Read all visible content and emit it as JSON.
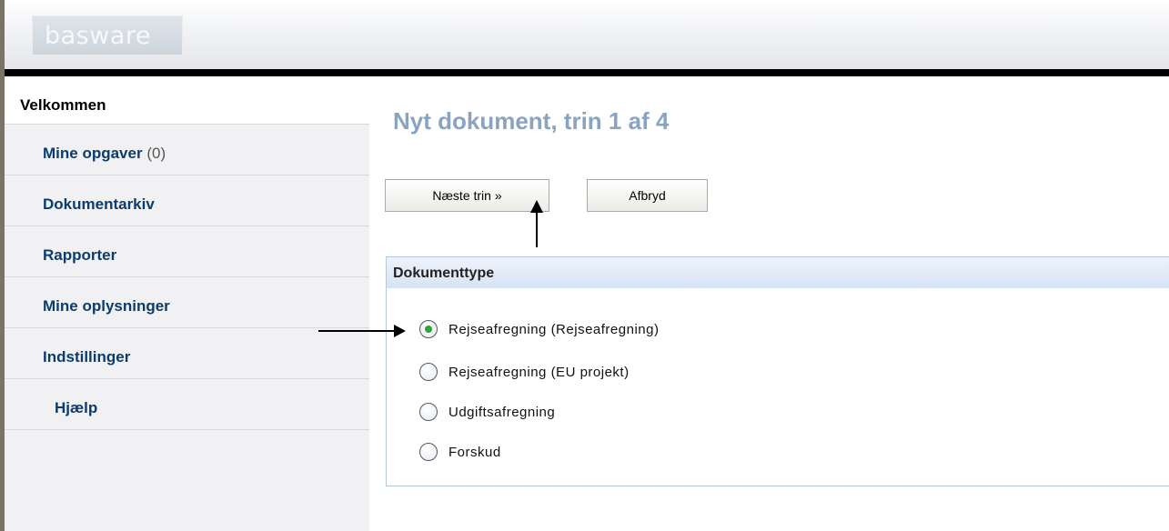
{
  "header": {
    "logo_text": "basware"
  },
  "sidebar": {
    "home_label": "Velkommen",
    "items": [
      {
        "label": "Mine opgaver",
        "count": "(0)"
      },
      {
        "label": "Dokumentarkiv"
      },
      {
        "label": "Rapporter"
      },
      {
        "label": "Mine oplysninger"
      },
      {
        "label": "Indstillinger"
      },
      {
        "label": "Hjælp"
      }
    ]
  },
  "main": {
    "title": "Nyt dokument, trin 1 af 4",
    "buttons": {
      "next": "Næste trin »",
      "cancel": "Afbryd"
    },
    "doc_type": {
      "heading": "Dokumenttype",
      "selected": "Rejseafregning (Rejseafregning)",
      "options": [
        "Rejseafregning (Rejseafregning)",
        "Rejseafregning (EU projekt)",
        "Udgiftsafregning",
        "Forskud"
      ]
    }
  },
  "colors": {
    "nav_link": "#0a3d6e",
    "title": "#8aa4c0",
    "radio_selected": "#2da53b"
  }
}
